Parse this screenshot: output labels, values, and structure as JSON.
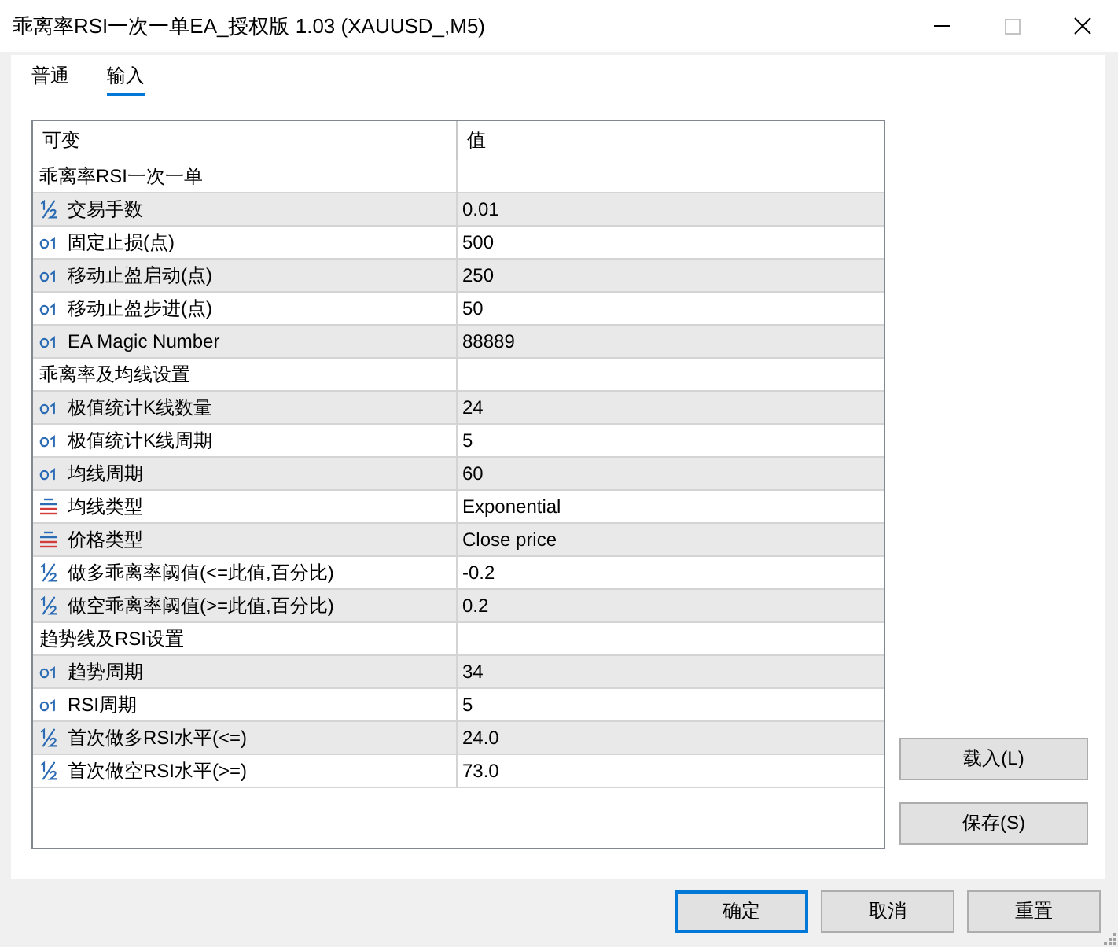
{
  "window": {
    "title": "乖离率RSI一次一单EA_授权版 1.03 (XAUUSD_,M5)",
    "maximize_disabled": true
  },
  "tabs": [
    {
      "label": "普通",
      "selected": false
    },
    {
      "label": "输入",
      "selected": true
    }
  ],
  "table": {
    "columns": [
      "可变",
      "值"
    ],
    "rows": [
      {
        "kind": "group",
        "name": "乖离率RSI一次一单"
      },
      {
        "kind": "double",
        "name": "交易手数",
        "value": "0.01"
      },
      {
        "kind": "integer",
        "name": "固定止损(点)",
        "value": "500"
      },
      {
        "kind": "integer",
        "name": "移动止盈启动(点)",
        "value": "250"
      },
      {
        "kind": "integer",
        "name": "移动止盈步进(点)",
        "value": "50"
      },
      {
        "kind": "integer",
        "name": "EA Magic Number",
        "value": "88889"
      },
      {
        "kind": "group",
        "name": "乖离率及均线设置"
      },
      {
        "kind": "integer",
        "name": "极值统计K线数量",
        "value": "24"
      },
      {
        "kind": "integer",
        "name": "极值统计K线周期",
        "value": "5"
      },
      {
        "kind": "integer",
        "name": "均线周期",
        "value": "60"
      },
      {
        "kind": "enum",
        "name": "均线类型",
        "value": "Exponential"
      },
      {
        "kind": "enum",
        "name": "价格类型",
        "value": "Close price"
      },
      {
        "kind": "double",
        "name": "做多乖离率阈值(<=此值,百分比)",
        "value": "-0.2"
      },
      {
        "kind": "double",
        "name": "做空乖离率阈值(>=此值,百分比)",
        "value": "0.2"
      },
      {
        "kind": "group",
        "name": "趋势线及RSI设置"
      },
      {
        "kind": "integer",
        "name": "趋势周期",
        "value": "34"
      },
      {
        "kind": "integer",
        "name": "RSI周期",
        "value": "5"
      },
      {
        "kind": "double",
        "name": "首次做多RSI水平(<=)",
        "value": "24.0"
      },
      {
        "kind": "double",
        "name": "首次做空RSI水平(>=)",
        "value": "73.0"
      }
    ]
  },
  "side_buttons": [
    "载入(L)",
    "保存(S)"
  ],
  "buttons": [
    {
      "label": "确定",
      "default": true
    },
    {
      "label": "取消",
      "default": false
    },
    {
      "label": "重置",
      "default": false
    }
  ]
}
